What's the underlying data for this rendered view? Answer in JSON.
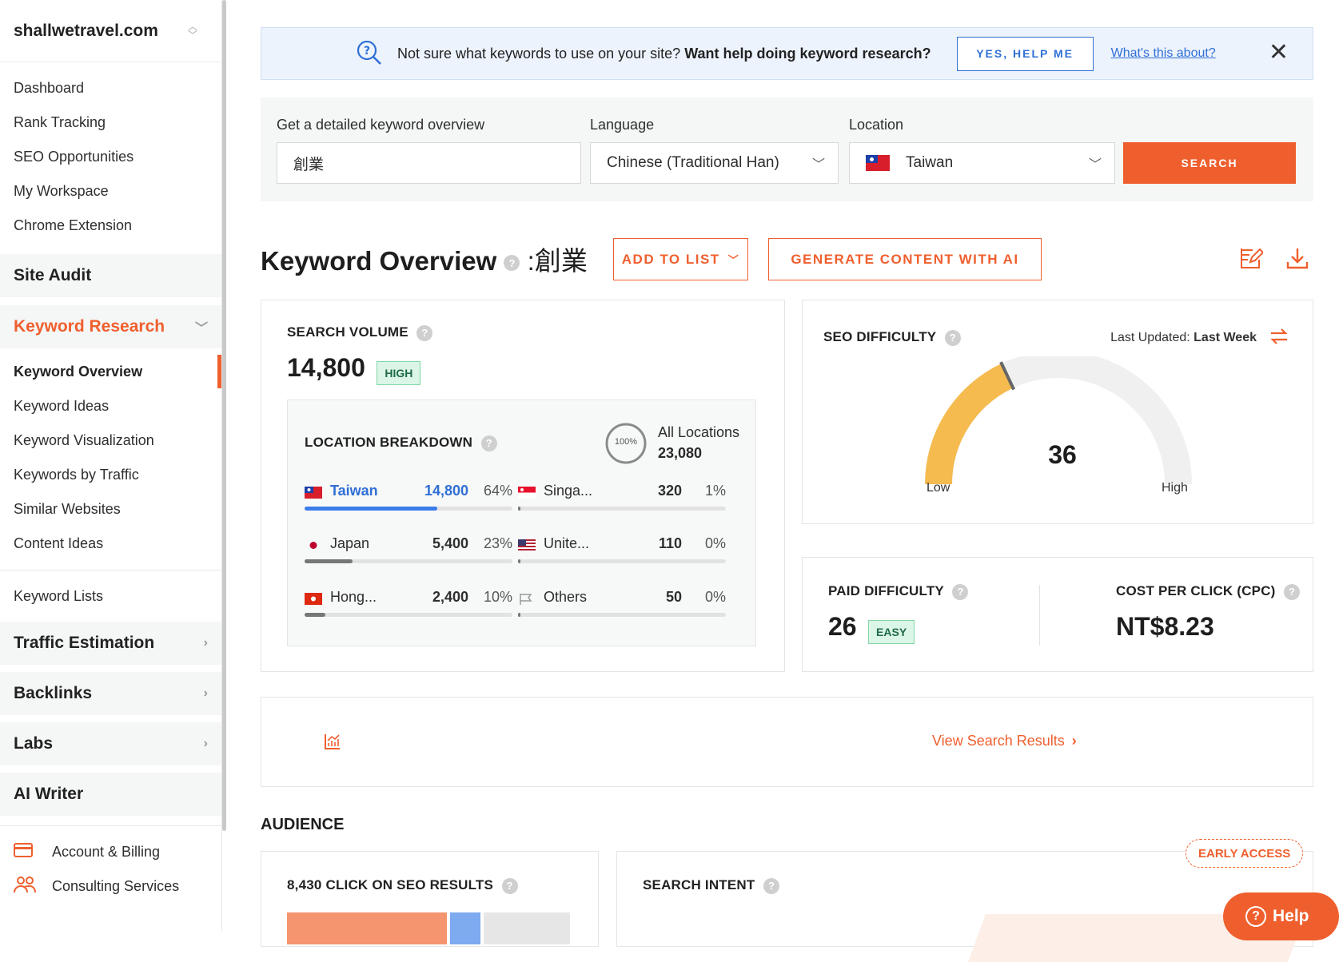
{
  "sidebar": {
    "site": "shallwetravel.com",
    "top_links": [
      "Dashboard",
      "Rank Tracking",
      "SEO Opportunities",
      "My Workspace",
      "Chrome Extension"
    ],
    "site_audit": "Site Audit",
    "keyword_research": "Keyword Research",
    "kr_items": [
      "Keyword Overview",
      "Keyword Ideas",
      "Keyword Visualization",
      "Keywords by Traffic",
      "Similar Websites",
      "Content Ideas"
    ],
    "keyword_lists": "Keyword Lists",
    "traffic_estimation": "Traffic Estimation",
    "backlinks": "Backlinks",
    "labs": "Labs",
    "ai_writer": "AI Writer",
    "account_billing": "Account & Billing",
    "consulting": "Consulting Services"
  },
  "banner": {
    "text": "Not sure what keywords to use on your site?",
    "bold": "Want help doing keyword research?",
    "button": "YES, HELP ME",
    "link": "What's this about?"
  },
  "search": {
    "keyword_label": "Get a detailed keyword overview",
    "keyword_value": "創業",
    "language_label": "Language",
    "language_value": "Chinese (Traditional Han)",
    "location_label": "Location",
    "location_value": "Taiwan",
    "button": "SEARCH"
  },
  "overview": {
    "title": "Keyword Overview",
    "keyword": "創業",
    "add_to_list": "ADD TO LIST",
    "generate": "GENERATE CONTENT WITH AI"
  },
  "volume": {
    "title": "SEARCH VOLUME",
    "value": "14,800",
    "badge": "HIGH",
    "breakdown_title": "LOCATION BREAKDOWN",
    "ring_pct": "100%",
    "all_locations": "All Locations",
    "all_total": "23,080",
    "rows": [
      {
        "name": "Taiwan",
        "volume": "14,800",
        "pct": "64%",
        "share": 0.64
      },
      {
        "name": "Singa...",
        "volume": "320",
        "pct": "1%",
        "share": 0.01
      },
      {
        "name": "Japan",
        "volume": "5,400",
        "pct": "23%",
        "share": 0.23
      },
      {
        "name": "Unite...",
        "volume": "110",
        "pct": "0%",
        "share": 0.0
      },
      {
        "name": "Hong...",
        "volume": "2,400",
        "pct": "10%",
        "share": 0.1
      },
      {
        "name": "Others",
        "volume": "50",
        "pct": "0%",
        "share": 0.0
      }
    ]
  },
  "seo_difficulty": {
    "title": "SEO DIFFICULTY",
    "updated_label": "Last Updated:",
    "updated_value": "Last Week",
    "value": "36",
    "score": 36,
    "low": "Low",
    "high": "High"
  },
  "paid": {
    "title": "PAID DIFFICULTY",
    "value": "26",
    "badge": "EASY"
  },
  "cpc": {
    "title": "COST PER CLICK (CPC)",
    "value": "NT$8.23"
  },
  "serp": {
    "link": "View Search Results"
  },
  "audience": {
    "title": "AUDIENCE",
    "clicks_title": "8,430 CLICK ON SEO RESULTS",
    "intent_title": "SEARCH INTENT",
    "early_access": "EARLY ACCESS"
  },
  "help": "Help",
  "colors": {
    "accent": "#ef5f2e",
    "blue": "#2f6fd6",
    "gauge": "#f5bb4f"
  }
}
